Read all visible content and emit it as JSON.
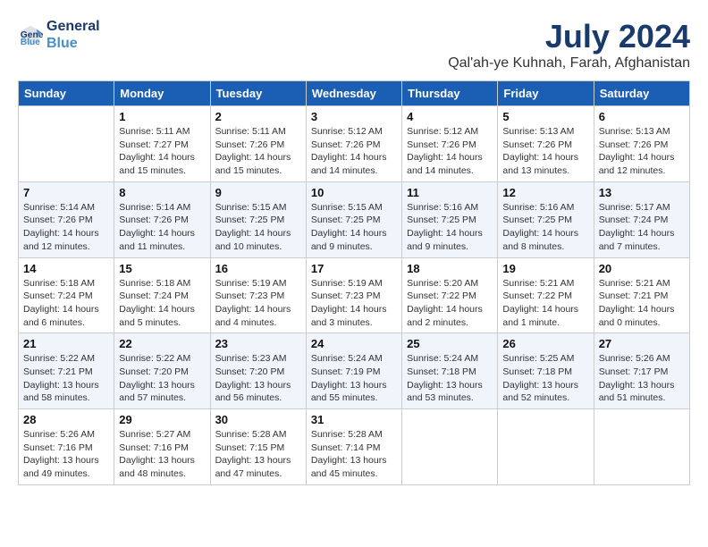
{
  "logo": {
    "line1": "General",
    "line2": "Blue"
  },
  "title": "July 2024",
  "location": "Qal'ah-ye Kuhnah, Farah, Afghanistan",
  "days_of_week": [
    "Sunday",
    "Monday",
    "Tuesday",
    "Wednesday",
    "Thursday",
    "Friday",
    "Saturday"
  ],
  "weeks": [
    [
      {
        "day": "",
        "info": ""
      },
      {
        "day": "1",
        "info": "Sunrise: 5:11 AM\nSunset: 7:27 PM\nDaylight: 14 hours\nand 15 minutes."
      },
      {
        "day": "2",
        "info": "Sunrise: 5:11 AM\nSunset: 7:26 PM\nDaylight: 14 hours\nand 15 minutes."
      },
      {
        "day": "3",
        "info": "Sunrise: 5:12 AM\nSunset: 7:26 PM\nDaylight: 14 hours\nand 14 minutes."
      },
      {
        "day": "4",
        "info": "Sunrise: 5:12 AM\nSunset: 7:26 PM\nDaylight: 14 hours\nand 14 minutes."
      },
      {
        "day": "5",
        "info": "Sunrise: 5:13 AM\nSunset: 7:26 PM\nDaylight: 14 hours\nand 13 minutes."
      },
      {
        "day": "6",
        "info": "Sunrise: 5:13 AM\nSunset: 7:26 PM\nDaylight: 14 hours\nand 12 minutes."
      }
    ],
    [
      {
        "day": "7",
        "info": "Sunrise: 5:14 AM\nSunset: 7:26 PM\nDaylight: 14 hours\nand 12 minutes."
      },
      {
        "day": "8",
        "info": "Sunrise: 5:14 AM\nSunset: 7:26 PM\nDaylight: 14 hours\nand 11 minutes."
      },
      {
        "day": "9",
        "info": "Sunrise: 5:15 AM\nSunset: 7:25 PM\nDaylight: 14 hours\nand 10 minutes."
      },
      {
        "day": "10",
        "info": "Sunrise: 5:15 AM\nSunset: 7:25 PM\nDaylight: 14 hours\nand 9 minutes."
      },
      {
        "day": "11",
        "info": "Sunrise: 5:16 AM\nSunset: 7:25 PM\nDaylight: 14 hours\nand 9 minutes."
      },
      {
        "day": "12",
        "info": "Sunrise: 5:16 AM\nSunset: 7:25 PM\nDaylight: 14 hours\nand 8 minutes."
      },
      {
        "day": "13",
        "info": "Sunrise: 5:17 AM\nSunset: 7:24 PM\nDaylight: 14 hours\nand 7 minutes."
      }
    ],
    [
      {
        "day": "14",
        "info": "Sunrise: 5:18 AM\nSunset: 7:24 PM\nDaylight: 14 hours\nand 6 minutes."
      },
      {
        "day": "15",
        "info": "Sunrise: 5:18 AM\nSunset: 7:24 PM\nDaylight: 14 hours\nand 5 minutes."
      },
      {
        "day": "16",
        "info": "Sunrise: 5:19 AM\nSunset: 7:23 PM\nDaylight: 14 hours\nand 4 minutes."
      },
      {
        "day": "17",
        "info": "Sunrise: 5:19 AM\nSunset: 7:23 PM\nDaylight: 14 hours\nand 3 minutes."
      },
      {
        "day": "18",
        "info": "Sunrise: 5:20 AM\nSunset: 7:22 PM\nDaylight: 14 hours\nand 2 minutes."
      },
      {
        "day": "19",
        "info": "Sunrise: 5:21 AM\nSunset: 7:22 PM\nDaylight: 14 hours\nand 1 minute."
      },
      {
        "day": "20",
        "info": "Sunrise: 5:21 AM\nSunset: 7:21 PM\nDaylight: 14 hours\nand 0 minutes."
      }
    ],
    [
      {
        "day": "21",
        "info": "Sunrise: 5:22 AM\nSunset: 7:21 PM\nDaylight: 13 hours\nand 58 minutes."
      },
      {
        "day": "22",
        "info": "Sunrise: 5:22 AM\nSunset: 7:20 PM\nDaylight: 13 hours\nand 57 minutes."
      },
      {
        "day": "23",
        "info": "Sunrise: 5:23 AM\nSunset: 7:20 PM\nDaylight: 13 hours\nand 56 minutes."
      },
      {
        "day": "24",
        "info": "Sunrise: 5:24 AM\nSunset: 7:19 PM\nDaylight: 13 hours\nand 55 minutes."
      },
      {
        "day": "25",
        "info": "Sunrise: 5:24 AM\nSunset: 7:18 PM\nDaylight: 13 hours\nand 53 minutes."
      },
      {
        "day": "26",
        "info": "Sunrise: 5:25 AM\nSunset: 7:18 PM\nDaylight: 13 hours\nand 52 minutes."
      },
      {
        "day": "27",
        "info": "Sunrise: 5:26 AM\nSunset: 7:17 PM\nDaylight: 13 hours\nand 51 minutes."
      }
    ],
    [
      {
        "day": "28",
        "info": "Sunrise: 5:26 AM\nSunset: 7:16 PM\nDaylight: 13 hours\nand 49 minutes."
      },
      {
        "day": "29",
        "info": "Sunrise: 5:27 AM\nSunset: 7:16 PM\nDaylight: 13 hours\nand 48 minutes."
      },
      {
        "day": "30",
        "info": "Sunrise: 5:28 AM\nSunset: 7:15 PM\nDaylight: 13 hours\nand 47 minutes."
      },
      {
        "day": "31",
        "info": "Sunrise: 5:28 AM\nSunset: 7:14 PM\nDaylight: 13 hours\nand 45 minutes."
      },
      {
        "day": "",
        "info": ""
      },
      {
        "day": "",
        "info": ""
      },
      {
        "day": "",
        "info": ""
      }
    ]
  ]
}
